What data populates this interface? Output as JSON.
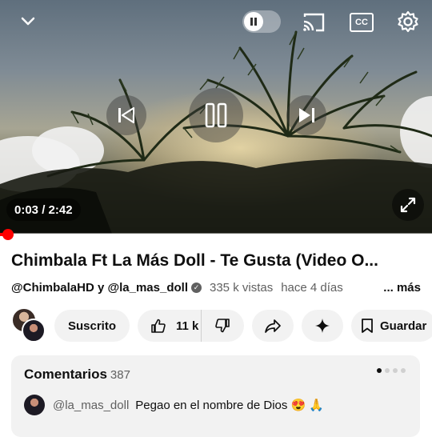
{
  "player": {
    "time_display": "0:03 / 2:42",
    "progress_fraction": 0.019,
    "icons": {
      "collapse": "chevron-down-icon",
      "autoplay": "autoplay-toggle-pause-icon",
      "cast": "cast-icon",
      "captions": "captions-cc-icon",
      "settings": "gear-icon",
      "previous": "skip-previous-icon",
      "play_pause": "pause-icon",
      "next": "skip-next-icon",
      "fullscreen": "fullscreen-icon"
    },
    "captions_label": "CC"
  },
  "video": {
    "title": "Chimbala Ft La Más Doll - Te Gusta (Video O...",
    "channels": "@ChimbalaHD y @la_mas_doll",
    "views": "335 k vistas",
    "age": "hace 4 días",
    "more_label": "... más"
  },
  "actions": {
    "subscribe_label": "Suscrito",
    "like_count": "11 k",
    "save_label": "Guardar"
  },
  "comments": {
    "title": "Comentarios",
    "count": "387",
    "top_comment": {
      "user": "@la_mas_doll",
      "text": "Pegao en el nombre de Dios 😍 🙏"
    }
  },
  "colors": {
    "progress": "#ff0000",
    "text_primary": "#0f0f0f",
    "text_secondary": "#606060",
    "pill_bg": "#f2f2f2"
  }
}
